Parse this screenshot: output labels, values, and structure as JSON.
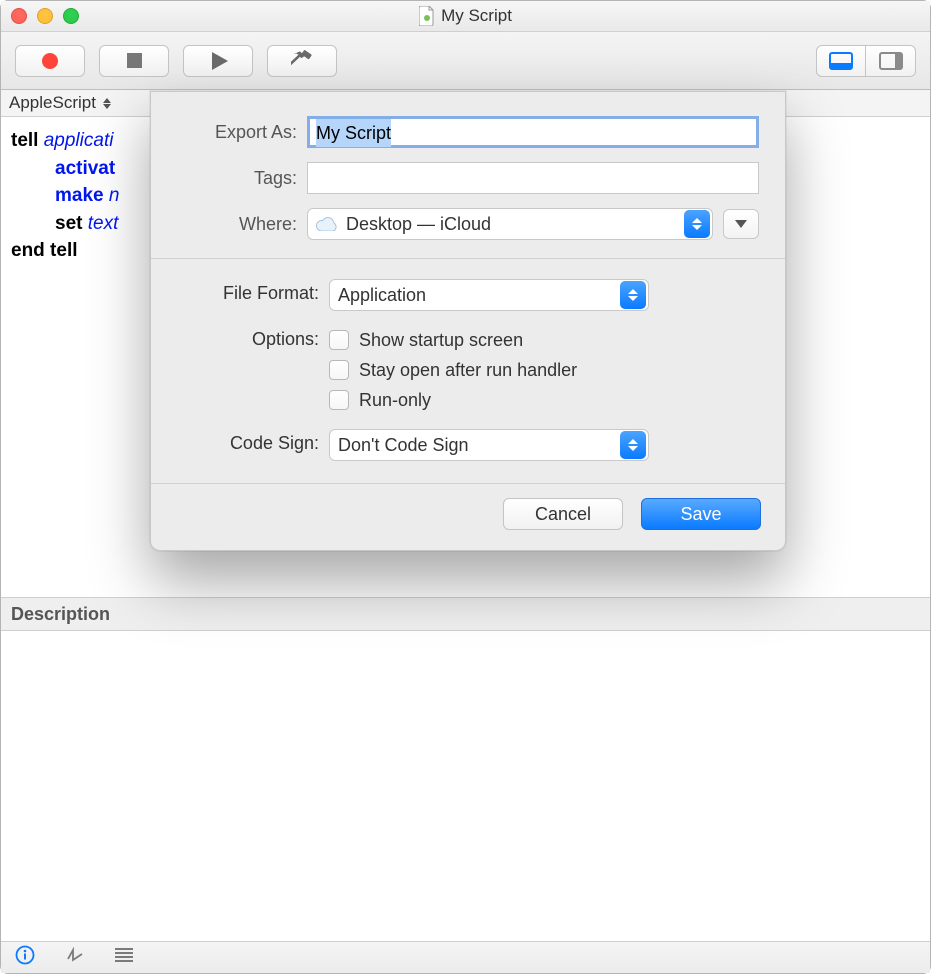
{
  "window": {
    "title": "My Script"
  },
  "langbar": {
    "language": "AppleScript"
  },
  "editor": {
    "line1_kw": "tell",
    "line1_rest": "applicati",
    "line2": "activat",
    "line3_kw": "make",
    "line3_rest": "n",
    "line4_kw": "set",
    "line4_rest": "text",
    "line5": "end tell"
  },
  "description": {
    "header": "Description"
  },
  "sheet": {
    "exportAsLabel": "Export As:",
    "exportAsValue": "My Script",
    "tagsLabel": "Tags:",
    "tagsValue": "",
    "whereLabel": "Where:",
    "whereValue": "Desktop — iCloud",
    "fileFormatLabel": "File Format:",
    "fileFormatValue": "Application",
    "optionsLabel": "Options:",
    "option1": "Show startup screen",
    "option2": "Stay open after run handler",
    "option3": "Run-only",
    "codeSignLabel": "Code Sign:",
    "codeSignValue": "Don't Code Sign",
    "cancel": "Cancel",
    "save": "Save"
  }
}
